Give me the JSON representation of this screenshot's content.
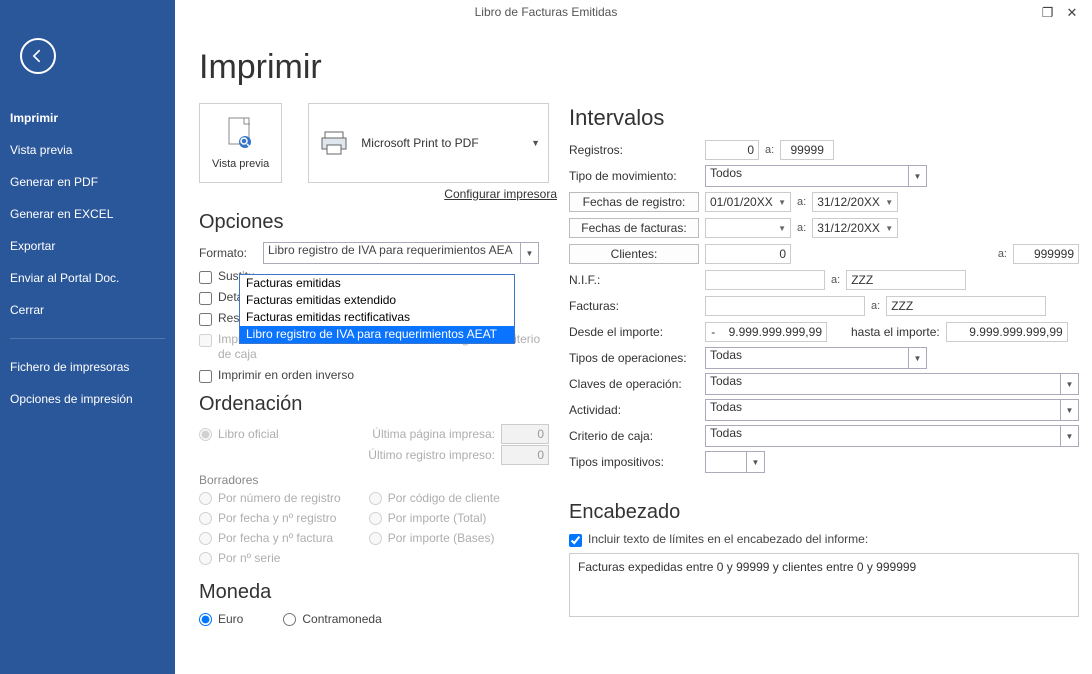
{
  "window_title": "Libro de Facturas Emitidas",
  "sidebar": {
    "items": [
      {
        "label": "Imprimir",
        "bold": true
      },
      {
        "label": "Vista previa"
      },
      {
        "label": "Generar en PDF"
      },
      {
        "label": "Generar en EXCEL"
      },
      {
        "label": "Exportar"
      },
      {
        "label": "Enviar al Portal Doc."
      },
      {
        "label": "Cerrar"
      }
    ],
    "items2": [
      {
        "label": "Fichero de impresoras"
      },
      {
        "label": "Opciones de impresión"
      }
    ]
  },
  "print_page_title": "Imprimir",
  "vista_previa_label": "Vista previa",
  "printer_name": "Microsoft Print to PDF",
  "config_printer": "Configurar impresora",
  "sections": {
    "opciones": "Opciones",
    "ordenacion": "Ordenación",
    "moneda": "Moneda",
    "intervalos": "Intervalos",
    "encabezado": "Encabezado"
  },
  "formato": {
    "label": "Formato:",
    "selected": "Libro registro de IVA para requerimientos AEA",
    "options": [
      "Facturas emitidas",
      "Facturas emitidas extendido",
      "Facturas emitidas rectificativas",
      "Libro registro de IVA para requerimientos AEAT"
    ],
    "selected_index": 3
  },
  "checkboxes": {
    "sustitu": "Sustitu",
    "detalla": "Detalla",
    "resumi": "Resumi",
    "imprimir_info": "Imprimir información de cobro en facturas acogidas a criterio de caja",
    "imprimir_orden": "Imprimir en orden inverso"
  },
  "ordenacion": {
    "main": "Libro oficial",
    "last_page_label": "Última página impresa:",
    "last_page_val": "0",
    "last_reg_label": "Último registro impreso:",
    "last_reg_val": "0",
    "borradores": "Borradores",
    "radios_left": [
      "Por número de registro",
      "Por fecha y nº registro",
      "Por fecha y nº factura",
      "Por nº serie"
    ],
    "radios_right": [
      "Por código de cliente",
      "Por importe (Total)",
      "Por importe (Bases)"
    ]
  },
  "moneda": {
    "euro": "Euro",
    "contra": "Contramoneda"
  },
  "intervalos": {
    "registros_label": "Registros:",
    "registros_from": "0",
    "registros_to": "99999",
    "a": "a:",
    "tipo_mov_label": "Tipo de movimiento:",
    "tipo_mov_val": "Todos",
    "fechas_registro_btn": "Fechas de registro:",
    "fechas_facturas_btn": "Fechas de facturas:",
    "date_from": "01/01/20XX",
    "date_to": "31/12/20XX",
    "date_to2": "31/12/20XX",
    "clientes_btn": "Clientes:",
    "clientes_from": "0",
    "clientes_to": "999999",
    "nif_label": "N.I.F.:",
    "zzz": "ZZZ",
    "facturas_label": "Facturas:",
    "desde_label": "Desde el importe:",
    "desde_val": "-    9.999.999.999,99",
    "hasta_label": "hasta el importe:",
    "hasta_val": "9.999.999.999,99",
    "tipos_op_label": "Tipos de operaciones:",
    "tipos_op_val": "Todas",
    "claves_label": "Claves de operación:",
    "claves_val": "Todas",
    "actividad_label": "Actividad:",
    "actividad_val": "Todas",
    "criterio_label": "Criterio de caja:",
    "criterio_val": "Todas",
    "tipos_imp_label": "Tipos impositivos:"
  },
  "encabezado": {
    "include_label": "Incluir texto de límites en el encabezado del informe:",
    "text": "Facturas expedidas entre 0 y 99999 y clientes entre 0 y 999999"
  }
}
